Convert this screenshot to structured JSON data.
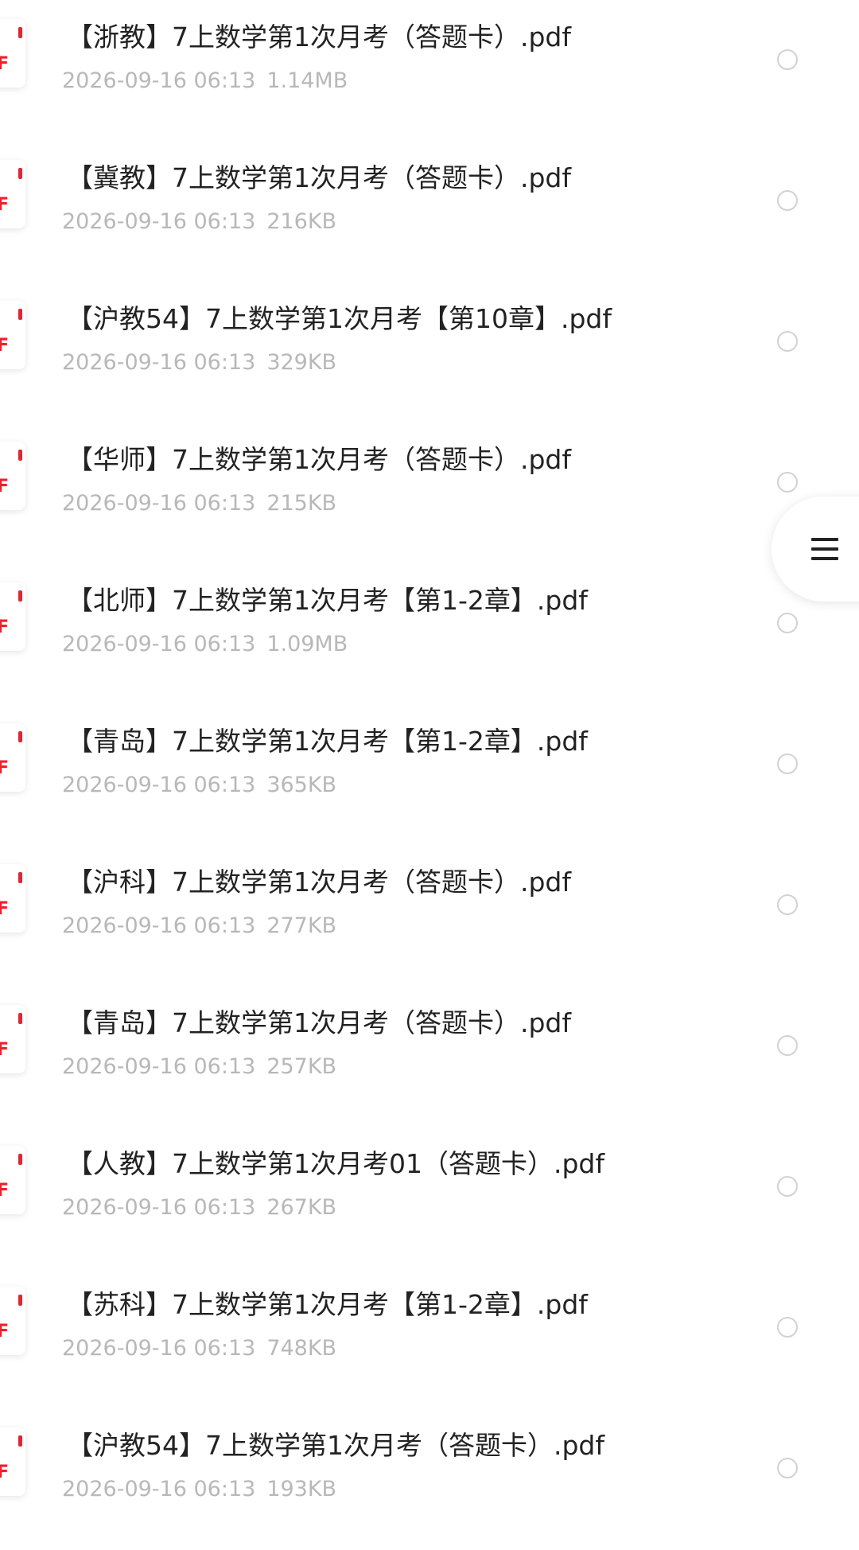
{
  "files": [
    {
      "name": "【浙教】7上数学第1次月考（答题卡）.pdf",
      "date": "2026-09-16 06:13",
      "size": "1.14MB",
      "icon": "pdf-file-icon",
      "ext_letter": "F"
    },
    {
      "name": "【冀教】7上数学第1次月考（答题卡）.pdf",
      "date": "2026-09-16 06:13",
      "size": "216KB",
      "icon": "pdf-file-icon",
      "ext_letter": "F"
    },
    {
      "name": "【沪教54】7上数学第1次月考【第10章】.pdf",
      "date": "2026-09-16 06:13",
      "size": "329KB",
      "icon": "pdf-file-icon",
      "ext_letter": "F"
    },
    {
      "name": "【华师】7上数学第1次月考（答题卡）.pdf",
      "date": "2026-09-16 06:13",
      "size": "215KB",
      "icon": "pdf-file-icon",
      "ext_letter": "F"
    },
    {
      "name": "【北师】7上数学第1次月考【第1-2章】.pdf",
      "date": "2026-09-16 06:13",
      "size": "1.09MB",
      "icon": "pdf-file-icon",
      "ext_letter": "F"
    },
    {
      "name": "【青岛】7上数学第1次月考【第1-2章】.pdf",
      "date": "2026-09-16 06:13",
      "size": "365KB",
      "icon": "pdf-file-icon",
      "ext_letter": "F"
    },
    {
      "name": "【沪科】7上数学第1次月考（答题卡）.pdf",
      "date": "2026-09-16 06:13",
      "size": "277KB",
      "icon": "pdf-file-icon",
      "ext_letter": "F"
    },
    {
      "name": "【青岛】7上数学第1次月考（答题卡）.pdf",
      "date": "2026-09-16 06:13",
      "size": "257KB",
      "icon": "pdf-file-icon",
      "ext_letter": "F"
    },
    {
      "name": "【人教】7上数学第1次月考01（答题卡）.pdf",
      "date": "2026-09-16 06:13",
      "size": "267KB",
      "icon": "pdf-file-icon",
      "ext_letter": "F"
    },
    {
      "name": "【苏科】7上数学第1次月考【第1-2章】.pdf",
      "date": "2026-09-16 06:13",
      "size": "748KB",
      "icon": "pdf-file-icon",
      "ext_letter": "F"
    },
    {
      "name": "【沪教54】7上数学第1次月考（答题卡）.pdf",
      "date": "2026-09-16 06:13",
      "size": "193KB",
      "icon": "pdf-file-icon",
      "ext_letter": "F"
    }
  ],
  "float_menu": {
    "icon": "menu-icon"
  },
  "colors": {
    "pdf_red": "#e8232f",
    "title_text": "#222222",
    "meta_text": "#b8b8b8",
    "radio_border": "#d2d2d2"
  }
}
